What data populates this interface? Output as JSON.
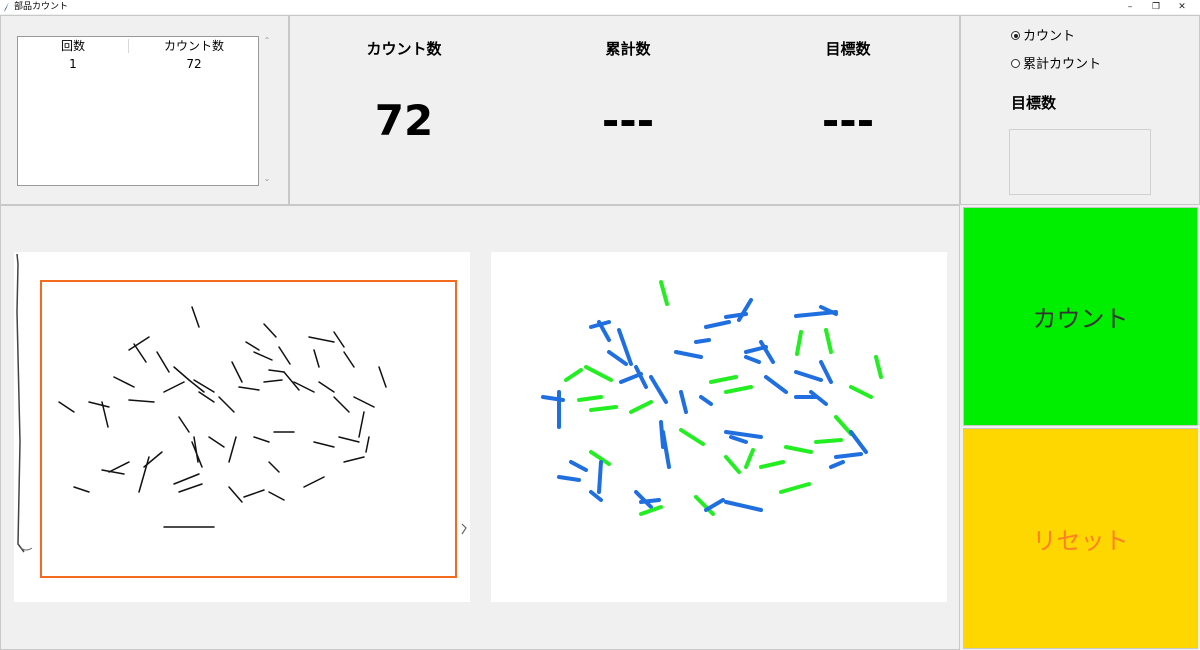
{
  "window": {
    "title": "部品カウント",
    "minimize": "–",
    "restore": "❐",
    "close": "✕",
    "app_icon": "feather-icon"
  },
  "history": {
    "columns": [
      "回数",
      "カウント数"
    ],
    "rows": [
      {
        "index": "1",
        "count": "72"
      }
    ]
  },
  "stats": {
    "count": {
      "label": "カウント数",
      "value": "72"
    },
    "cumulative": {
      "label": "累計数",
      "value": "---"
    },
    "target": {
      "label": "目標数",
      "value": "---"
    }
  },
  "mode": {
    "options": [
      {
        "label": "カウント",
        "checked": true
      },
      {
        "label": "累計カウント",
        "checked": false
      }
    ],
    "target_label": "目標数",
    "target_value": ""
  },
  "buttons": {
    "count": {
      "label": "カウント",
      "color": "#00ee00",
      "text_color": "#333333"
    },
    "reset": {
      "label": "リセット",
      "color": "#ffd700",
      "text_color": "#ff7f27"
    }
  },
  "images": {
    "camera": {
      "roi_color": "#f26b21",
      "item_color": "#111111"
    },
    "result": {
      "color_a": "#1f6fe0",
      "color_b": "#22ee22"
    }
  }
}
